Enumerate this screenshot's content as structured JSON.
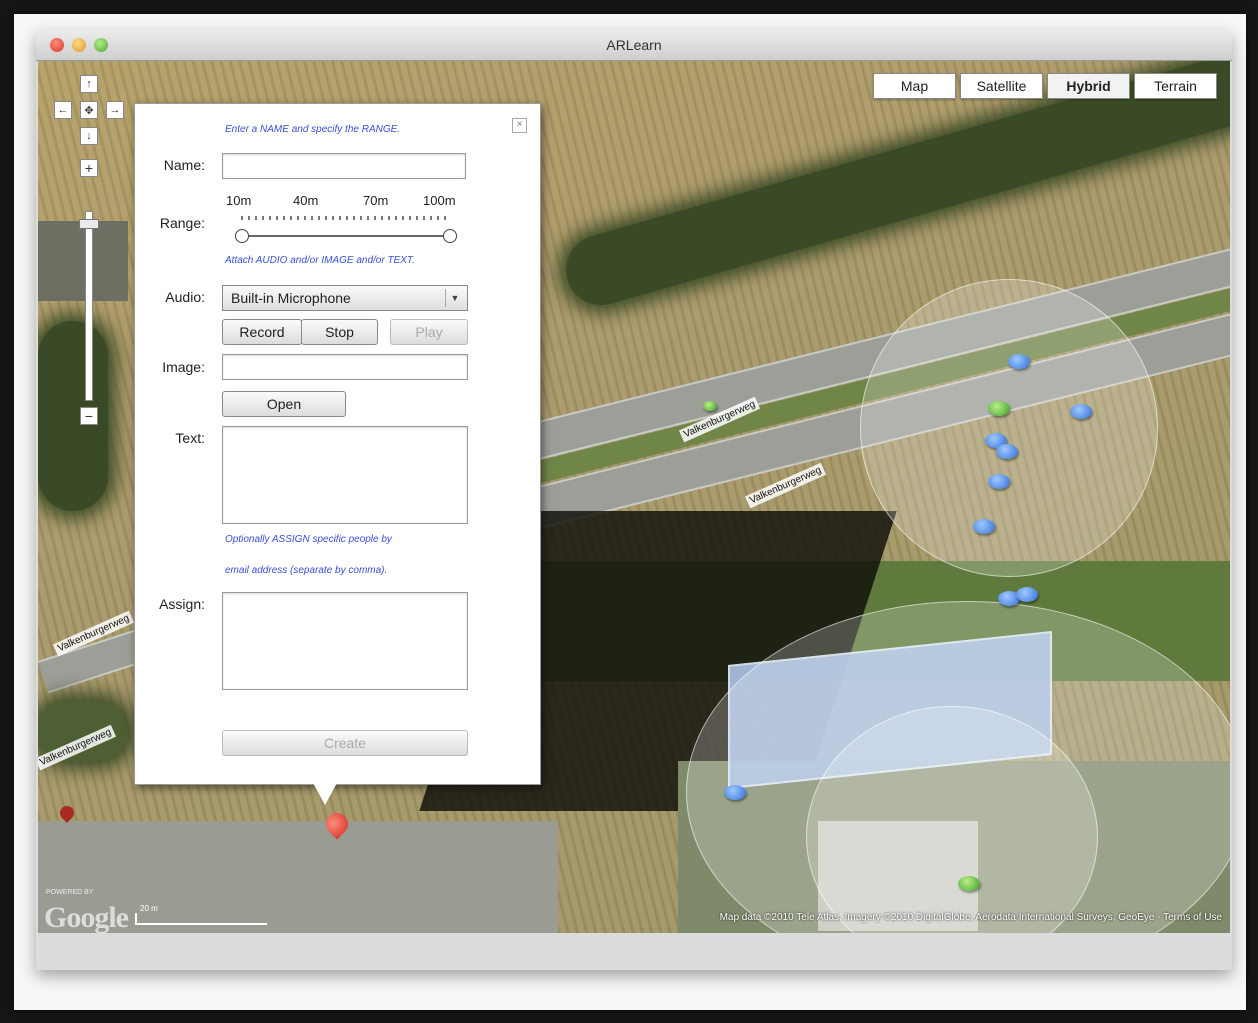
{
  "window": {
    "title": "ARLearn"
  },
  "map": {
    "types": [
      {
        "label": "Map",
        "active": false
      },
      {
        "label": "Satellite",
        "active": false
      },
      {
        "label": "Hybrid",
        "active": true
      },
      {
        "label": "Terrain",
        "active": false
      }
    ],
    "controls": {
      "pan_up": "↑",
      "pan_left": "←",
      "pan_center": "✥",
      "pan_right": "→",
      "pan_down": "↓",
      "zoom_in": "+",
      "zoom_out": "−"
    },
    "street_labels": [
      "Valkenburgerweg",
      "Valkenburgerweg",
      "Valkenburgerweg",
      "Valkenburgerweg"
    ],
    "branding": {
      "powered_by": "POWERED BY",
      "logo": "Google"
    },
    "scale_label": "20 m",
    "attribution": "Map data ©2010 Tele Atlas, Imagery ©2010 DigitalGlobe, Aerodata International Surveys, GeoEye - Terms of Use"
  },
  "form": {
    "hint_name_range": "Enter a NAME and specify the RANGE.",
    "name_label": "Name:",
    "name_value": "",
    "range_label": "Range:",
    "range_ticks": [
      "10m",
      "40m",
      "70m",
      "100m"
    ],
    "range_value": "10m – 100m",
    "hint_attach": "Attach AUDIO and/or IMAGE and/or TEXT.",
    "audio_label": "Audio:",
    "audio_selected": "Built-in Microphone",
    "record_label": "Record",
    "stop_label": "Stop",
    "play_label": "Play",
    "image_label": "Image:",
    "image_value": "",
    "open_label": "Open",
    "text_label": "Text:",
    "hint_assign_1": "Optionally ASSIGN specific people by",
    "hint_assign_2": "email address (separate by comma).",
    "assign_label": "Assign:",
    "create_label": "Create",
    "close_glyph": "×"
  }
}
